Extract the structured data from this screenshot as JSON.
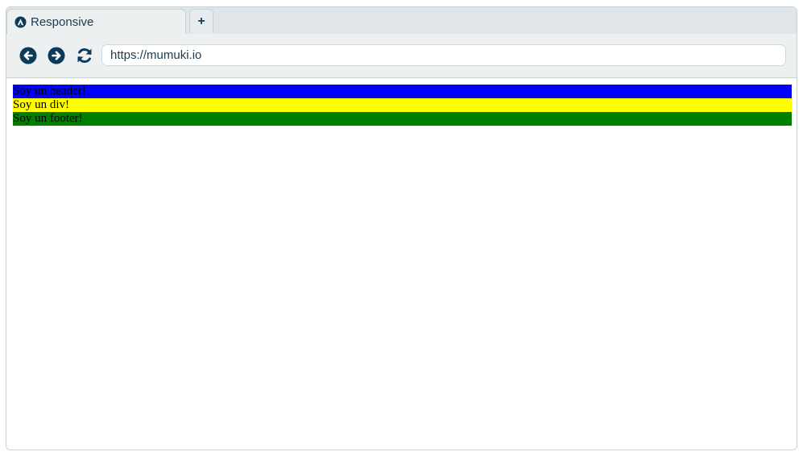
{
  "tab": {
    "title": "Responsive",
    "icon": "mumuki-logo-icon"
  },
  "new_tab": {
    "label": "+"
  },
  "toolbar": {
    "back_icon": "arrow-left-circle-icon",
    "forward_icon": "arrow-right-circle-icon",
    "reload_icon": "refresh-icon",
    "url": "https://mumuki.io"
  },
  "content": {
    "header": {
      "text": "Soy un header!",
      "color": "#0000ff"
    },
    "div": {
      "text": "Soy un div!",
      "color": "#ffff00"
    },
    "footer": {
      "text": "Soy un footer!",
      "color": "#008000"
    }
  },
  "colors": {
    "icon": "#0b3b5a",
    "chrome_bg": "#ecf0f1",
    "tabbar_bg": "#dfe5e8"
  }
}
